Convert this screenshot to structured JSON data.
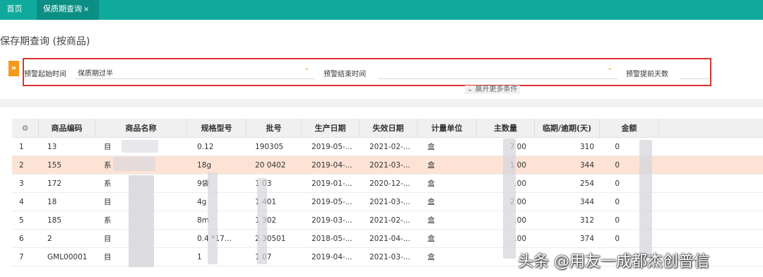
{
  "tabs": {
    "home": "首页",
    "active": "保质期查询",
    "close": "×"
  },
  "page_title": "保存期查询 (按商品)",
  "filter": {
    "expand_glyph": "»",
    "start_label": "预警起始时间",
    "start_value": "保质期过半",
    "end_label": "预警结束时间",
    "end_value": "",
    "days_label": "预警提前天数",
    "chevron": "⌄",
    "more": "⌄ 展开更多条件"
  },
  "table": {
    "settings_icon": "⚙",
    "headers": [
      "商品编码",
      "商品名称",
      "规格型号",
      "批号",
      "生产日期",
      "失效日期",
      "计量单位",
      "主数量",
      "临期/逾期(天)",
      "金额"
    ],
    "rows": [
      {
        "idx": "1",
        "code": "13",
        "name": "目",
        "spec": "0.12",
        "batch": "190305",
        "mfg": "2019-05-...",
        "exp": "2021-02-...",
        "unit": "盒",
        "qty": "7 00",
        "days": "310",
        "amt": "0"
      },
      {
        "idx": "2",
        "code": "155",
        "name": "系",
        "spec": "18g",
        "batch": "20 0402",
        "mfg": "2019-04-...",
        "exp": "2021-03-...",
        "unit": "盒",
        "qty": "1 00",
        "days": "344",
        "amt": "0"
      },
      {
        "idx": "3",
        "code": "172",
        "name": "系",
        "spec": "9袋",
        "batch": "1 03",
        "mfg": "2019-01-...",
        "exp": "2020-12-...",
        "unit": "盒",
        "qty": ".00",
        "days": "254",
        "amt": "0"
      },
      {
        "idx": "4",
        "code": "18",
        "name": "目",
        "spec": "4g",
        "batch": "1 401",
        "mfg": "2019-05-...",
        "exp": "2021-03-...",
        "unit": "盒",
        "qty": "2 00",
        "days": "344",
        "amt": "0"
      },
      {
        "idx": "5",
        "code": "185",
        "name": "系",
        "spec": "8m",
        "batch": "1 302",
        "mfg": "2019-03-...",
        "exp": "2021-02-...",
        "unit": "盒",
        "qty": ".00",
        "days": "312",
        "amt": "0"
      },
      {
        "idx": "6",
        "code": "2",
        "name": "目",
        "spec": "0.4 *17...",
        "batch": "2 30501",
        "mfg": "2018-05-...",
        "exp": "2021-04-...",
        "unit": "盒",
        "qty": ".00",
        "days": "374",
        "amt": "0"
      },
      {
        "idx": "7",
        "code": "GML00001",
        "name": "目",
        "spec": "1",
        "batch": "1 07",
        "mfg": "2019-04-...",
        "exp": "2021-03-...",
        "unit": "盒",
        "qty": "",
        "days": "",
        "amt": ""
      }
    ]
  },
  "watermark": "头条 @用友一成都杰创普信"
}
